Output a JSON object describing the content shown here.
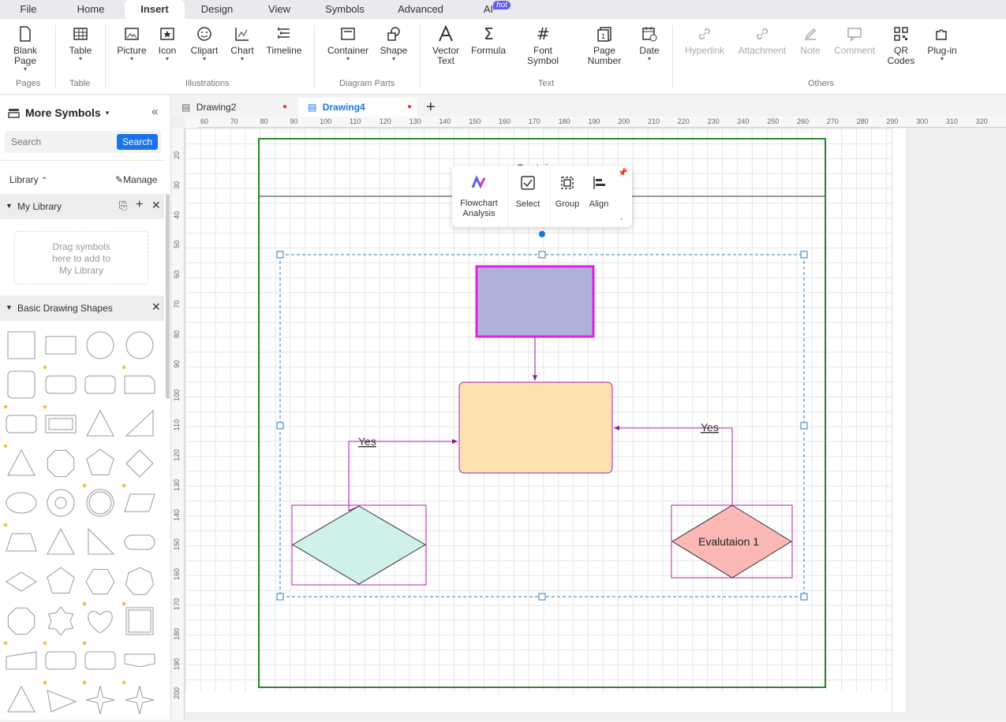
{
  "menubar": {
    "tabs": [
      "File",
      "Home",
      "Insert",
      "Design",
      "View",
      "Symbols",
      "Advanced",
      "AI"
    ],
    "active": "Insert",
    "ai_badge": "hot"
  },
  "ribbon": {
    "buttons": {
      "blank_page": "Blank\nPage",
      "table": "Table",
      "picture": "Picture",
      "icon": "Icon",
      "clipart": "Clipart",
      "chart": "Chart",
      "timeline": "Timeline",
      "container": "Container",
      "shape": "Shape",
      "vector_text": "Vector\nText",
      "formula": "Formula",
      "font_symbol": "Font\nSymbol",
      "page_number": "Page\nNumber",
      "date": "Date",
      "hyperlink": "Hyperlink",
      "attachment": "Attachment",
      "note": "Note",
      "comment": "Comment",
      "qr_codes": "QR\nCodes",
      "plugin": "Plug-in"
    },
    "groups": {
      "pages": "Pages",
      "table": "Table",
      "illustrations": "Illustrations",
      "diagram_parts": "Diagram Parts",
      "text": "Text",
      "others": "Others"
    }
  },
  "sidebar": {
    "title": "More Symbols",
    "search_placeholder": "Search",
    "search_button": "Search",
    "library_label": "Library",
    "manage_label": "Manage",
    "my_library": "My Library",
    "drag_hint": "Drag symbols\nhere to add to\nMy Library",
    "basic_shapes": "Basic Drawing Shapes"
  },
  "doc_tabs": [
    {
      "label": "Drawing2",
      "active": false,
      "unsaved": true
    },
    {
      "label": "Drawing4",
      "active": true,
      "unsaved": true
    }
  ],
  "ruler": {
    "h": [
      "60",
      "70",
      "80",
      "90",
      "100",
      "110",
      "120",
      "130",
      "140",
      "150",
      "160",
      "170",
      "180",
      "190",
      "200",
      "210",
      "220",
      "230",
      "240",
      "250",
      "260",
      "270",
      "280",
      "290",
      "300",
      "310",
      "320"
    ],
    "v": [
      "20",
      "30",
      "40",
      "50",
      "60",
      "70",
      "80",
      "90",
      "100",
      "110",
      "120",
      "130",
      "140",
      "150",
      "160",
      "170",
      "180",
      "190",
      "200"
    ]
  },
  "floating_toolbar": {
    "flowchart_analysis": "Flowchart\nAnalysis",
    "select": "Select",
    "group": "Group",
    "align": "Align"
  },
  "diagram": {
    "container_title": "Container",
    "yes_left": "Yes",
    "yes_right": "Yes",
    "evaluation_label": "Evalutaion 1",
    "colors": {
      "top_rect": "#b0b0dc",
      "top_rect_border": "#e020e0",
      "mid_rect": "#fde0b0",
      "left_diamond": "#d0f0ea",
      "right_diamond": "#fcb8b4",
      "connector": "#b020b0",
      "container_border": "#2a8a2a"
    }
  }
}
